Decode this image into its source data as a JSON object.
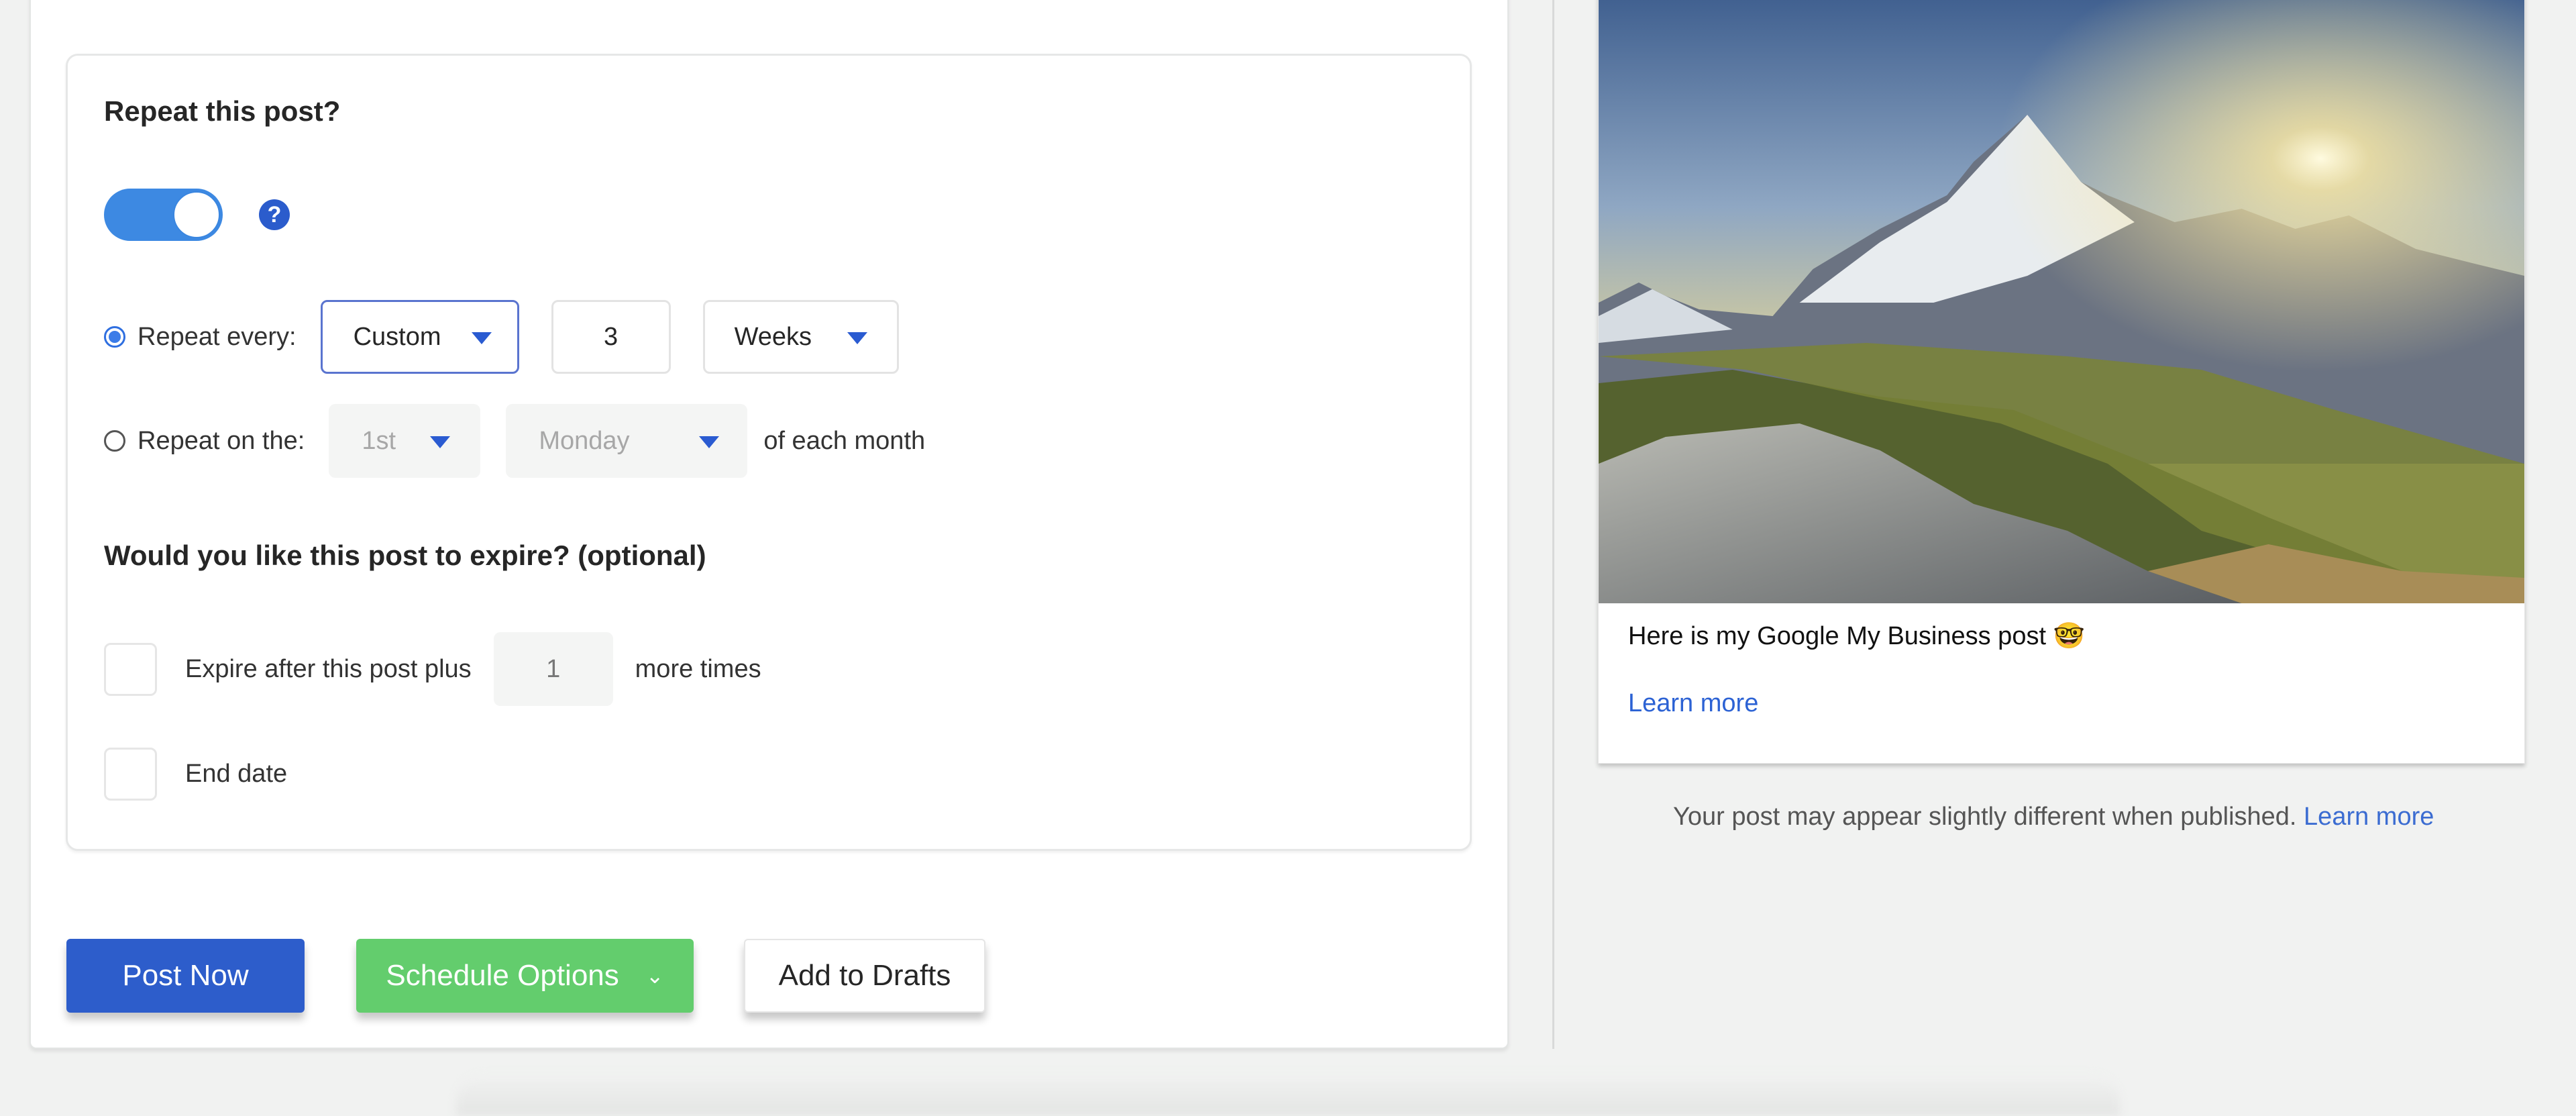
{
  "repeat": {
    "heading": "Repeat this post?",
    "toggle_on": true,
    "help_icon": "question-circle-icon",
    "help_glyph": "?",
    "every": {
      "selected": true,
      "label": "Repeat every:",
      "frequency": "Custom",
      "interval": "3",
      "unit": "Weeks"
    },
    "on_the": {
      "selected": false,
      "label": "Repeat on the:",
      "ordinal": "1st",
      "weekday": "Monday",
      "suffix": "of each month"
    }
  },
  "expire": {
    "heading": "Would you like this post to expire? (optional)",
    "after_posts": {
      "checked": false,
      "label_before": "Expire after this post plus",
      "count": "1",
      "label_after": "more times"
    },
    "end_date": {
      "checked": false,
      "label": "End date"
    }
  },
  "actions": {
    "post_now": "Post Now",
    "schedule_options": "Schedule Options",
    "schedule_chevron": "⌄",
    "add_to_drafts": "Add to Drafts"
  },
  "preview": {
    "image_alt": "Mountain sunrise landscape",
    "post_text": "Here is my Google My Business post 🤓",
    "learn_more": "Learn more",
    "disclaimer": "Your post may appear slightly different when published.",
    "disclaimer_link": "Learn more"
  },
  "colors": {
    "primary_blue": "#2d5dcb",
    "toggle_blue": "#3d89e2",
    "success_green": "#63cd6d",
    "link_blue": "#2c62d4"
  }
}
